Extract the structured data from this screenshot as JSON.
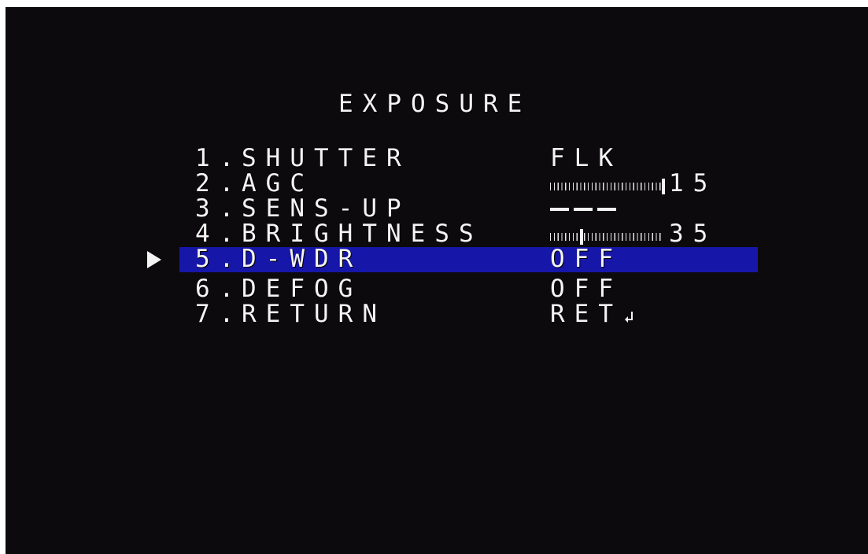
{
  "colors": {
    "background": "#0d0a0e",
    "text": "#f4f4f4",
    "selection": "#1616a8"
  },
  "menu": {
    "title": "EXPOSURE",
    "selected_index": 4,
    "pointer_icon": "pointer-triangle-icon",
    "items": [
      {
        "number": "1.",
        "label": "SHUTTER",
        "value_type": "text",
        "value": "FLK"
      },
      {
        "number": "2.",
        "label": "AGC",
        "value_type": "level",
        "value": "15",
        "level_fraction": 1.0
      },
      {
        "number": "3.",
        "label": "SENS-UP",
        "value_type": "dashes",
        "value": "---"
      },
      {
        "number": "4.",
        "label": "BRIGHTNESS",
        "value_type": "level",
        "value": "35",
        "level_fraction": 0.28
      },
      {
        "number": "5.",
        "label": "D-WDR",
        "value_type": "text",
        "value": "OFF"
      },
      {
        "number": "6.",
        "label": "DEFOG",
        "value_type": "text",
        "value": "OFF"
      },
      {
        "number": "7.",
        "label": "RETURN",
        "value_type": "text",
        "value": "RET",
        "icon": "return-arrow-icon"
      }
    ]
  }
}
